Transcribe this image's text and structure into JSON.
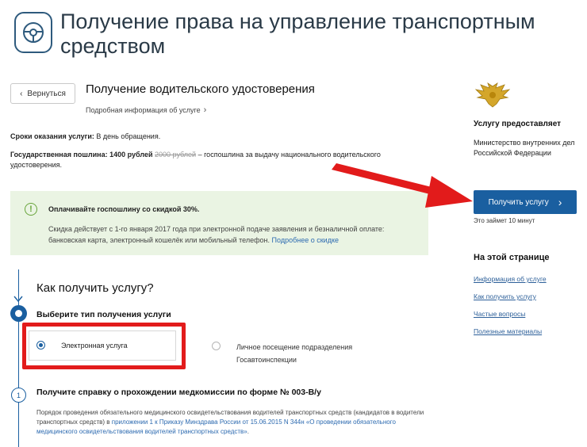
{
  "header": {
    "title": "Получение права на управление транспортным средством",
    "icon": "steering-wheel-icon"
  },
  "service": {
    "back_label": "Вернуться",
    "title": "Получение водительского удостоверения",
    "more_label": "Подробная информация об услуге",
    "terms_label": "Сроки оказания услуги:",
    "terms_value": "В день обращения.",
    "fee_label": "Государственная пошлина: 1400 рублей",
    "fee_old": "2000 рублей",
    "fee_rest": "– госпошлина за выдачу национального водительского удостоверения."
  },
  "note": {
    "icon": "exclamation-circle-icon",
    "title": "Оплачивайте госпошлину со скидкой 30%.",
    "body": "Скидка действует с 1-го января 2017 года при электронной подаче заявления и безналичной оплате: банковская карта, электронный кошелёк или мобильный телефон.",
    "link": "Подробнее о скидке",
    "accent": "#67a43a",
    "background": "#eaf4e3"
  },
  "provider": {
    "title": "Услугу предоставляет",
    "name": "Министерство внутренних дел Российской Федерации",
    "emblem": "eagle-emblem-icon"
  },
  "cta": {
    "label": "Получить услугу",
    "note": "Это займет 10 минут",
    "color": "#1a5fa0"
  },
  "toc": {
    "title": "На этой странице",
    "links": [
      "Информация об услуге",
      "Как получить услугу",
      "Частые вопросы",
      "Полезные материалы"
    ]
  },
  "steps": {
    "heading": "Как получить услугу?",
    "step1": {
      "title": "Выберите тип получения услуги",
      "options": [
        {
          "label": "Электронная услуга",
          "selected": true
        },
        {
          "label": "Личное посещение подразделения Госавтоинспекции",
          "selected": false
        }
      ]
    },
    "step2": {
      "number": "1",
      "title": "Получите справку о прохождении медкомиссии по форме № 003-В/у",
      "body_prefix": "Порядок проведения обязательного медицинского освидетельствования водителей транспортных средств (кандидатов в водители транспортных средств) в",
      "body_link": "приложении 1 к Приказу Минздрава России от 15.06.2015 N 344н «О проведении обязательного медицинского освидетельствования водителей транспортных средств»",
      "body_suffix": "."
    }
  },
  "annotation_color": "#e21b1b"
}
